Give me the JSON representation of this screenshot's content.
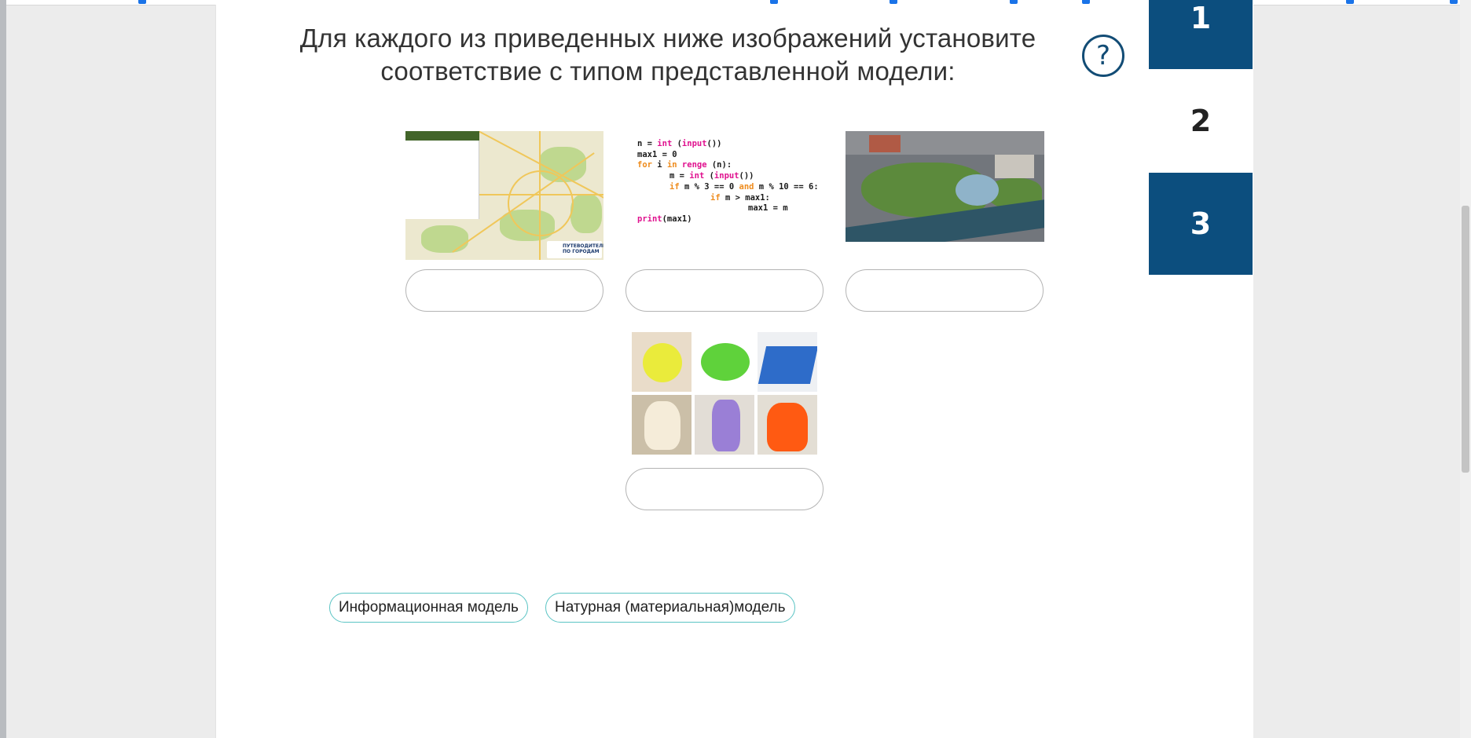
{
  "question": {
    "line1": "Для каждого из приведенных ниже изображений установите",
    "line2": "соответствие с типом представленной модели:"
  },
  "help_glyph": "?",
  "nav": [
    {
      "label": "1",
      "active": true
    },
    {
      "label": "2",
      "active": false
    },
    {
      "label": "3",
      "active": true
    }
  ],
  "images": {
    "map_badge": "ПУТЕВОДИТЕЛИ\nПО ГОРОДАМ",
    "code_lines": [
      "n = int (input())",
      "max1 = 0",
      "for i in renge (n):",
      "m = int (input())",
      "if m % 3 == 0 and m % 10 == 6:",
      "if m > max1:",
      "max1 = m",
      "print(max1)"
    ]
  },
  "dropzones": [
    "",
    "",
    "",
    ""
  ],
  "options": [
    {
      "label": "Информационная модель"
    },
    {
      "label": "Натурная (материальная)модель"
    }
  ],
  "colors": {
    "nav_active": "#0c4e7e",
    "option_border": "#5bc4c4",
    "help_icon": "#124c75"
  }
}
